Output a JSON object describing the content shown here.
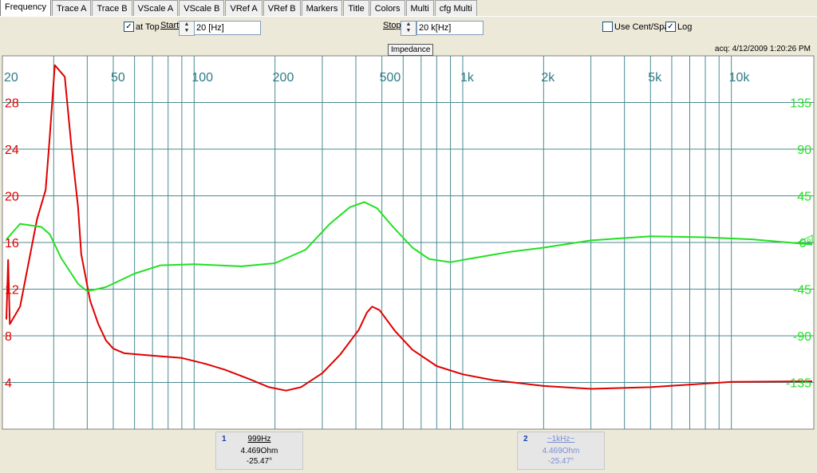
{
  "tabs": [
    "Frequency",
    "Trace A",
    "Trace B",
    "VScale A",
    "VScale B",
    "VRef A",
    "VRef B",
    "Markers",
    "Title",
    "Colors",
    "Multi",
    "cfg Multi"
  ],
  "active_tab": 0,
  "toolbar": {
    "at_top_label": "at Top",
    "at_top_checked": "✓",
    "start_label": "Start",
    "start_value": "20 [Hz]",
    "stop_label": "Stop",
    "stop_value": "20 k[Hz]",
    "use_cent_span_label": "Use Cent/Span",
    "use_cent_span_checked": "",
    "log_label": "Log",
    "log_checked": "✓"
  },
  "plot_title": "Impedance",
  "acq_time": "acq: 4/12/2009 1:20:26 PM",
  "markers": [
    {
      "num": "1",
      "freq": "999Hz",
      "mag": "4.469Ohm",
      "phase": "-25.47°"
    },
    {
      "num": "2",
      "freq": "~1kHz~",
      "mag": "4.469Ohm",
      "phase": "-25.47°"
    }
  ],
  "chart_data": {
    "type": "line",
    "title": "Impedance",
    "x_scale": "log",
    "xlim": [
      20,
      20000
    ],
    "x_ticks": [
      {
        "v": 20,
        "label": "20"
      },
      {
        "v": 50,
        "label": "50"
      },
      {
        "v": 100,
        "label": "100"
      },
      {
        "v": 200,
        "label": "200"
      },
      {
        "v": 500,
        "label": "500"
      },
      {
        "v": 1000,
        "label": "1k"
      },
      {
        "v": 2000,
        "label": "2k"
      },
      {
        "v": 5000,
        "label": "5k"
      },
      {
        "v": 10000,
        "label": "10k"
      }
    ],
    "ylim_left": [
      0,
      32
    ],
    "y_ticks_left": [
      4,
      8,
      12,
      16,
      20,
      24,
      28
    ],
    "ylim_right": [
      -180,
      180
    ],
    "y_ticks_right": [
      {
        "v": 135,
        "label": "135"
      },
      {
        "v": 90,
        "label": "90"
      },
      {
        "v": 45,
        "label": "45"
      },
      {
        "v": 0,
        "label": "0°"
      },
      {
        "v": -45,
        "label": "-45"
      },
      {
        "v": -90,
        "label": "-90"
      },
      {
        "v": -135,
        "label": "-135"
      }
    ],
    "grid": true,
    "colors": {
      "background": "#ffffff",
      "grid": "#4a8a92",
      "axis_text": "#2e7c86",
      "magnitude": "#e00000",
      "phase": "#22e022"
    },
    "series": [
      {
        "axis": "left",
        "color": "#e00000",
        "points": [
          [
            20,
            9.4
          ],
          [
            20.3,
            14.5
          ],
          [
            20.6,
            9.0
          ],
          [
            22.5,
            10.5
          ],
          [
            26,
            18
          ],
          [
            28,
            20.5
          ],
          [
            29,
            25
          ],
          [
            30.3,
            31.2
          ],
          [
            33,
            30.2
          ],
          [
            35,
            24
          ],
          [
            37,
            19
          ],
          [
            38,
            15
          ],
          [
            41,
            11
          ],
          [
            44,
            9
          ],
          [
            47,
            7.6
          ],
          [
            50,
            6.9
          ],
          [
            55,
            6.5
          ],
          [
            70,
            6.3
          ],
          [
            90,
            6.1
          ],
          [
            110,
            5.6
          ],
          [
            130,
            5.1
          ],
          [
            160,
            4.3
          ],
          [
            190,
            3.6
          ],
          [
            220,
            3.3
          ],
          [
            250,
            3.6
          ],
          [
            300,
            4.8
          ],
          [
            350,
            6.4
          ],
          [
            410,
            8.5
          ],
          [
            440,
            10.0
          ],
          [
            460,
            10.5
          ],
          [
            490,
            10.2
          ],
          [
            560,
            8.4
          ],
          [
            650,
            6.8
          ],
          [
            800,
            5.4
          ],
          [
            1000,
            4.7
          ],
          [
            1300,
            4.2
          ],
          [
            2000,
            3.7
          ],
          [
            3000,
            3.45
          ],
          [
            5000,
            3.6
          ],
          [
            10000,
            4.05
          ],
          [
            20000,
            4.1
          ]
        ]
      },
      {
        "axis": "right",
        "color": "#22e022",
        "points": [
          [
            20,
            3
          ],
          [
            22.5,
            18
          ],
          [
            27,
            15
          ],
          [
            29,
            8
          ],
          [
            32,
            -15
          ],
          [
            37,
            -40
          ],
          [
            40,
            -47
          ],
          [
            47,
            -43
          ],
          [
            60,
            -30
          ],
          [
            75,
            -22
          ],
          [
            100,
            -21
          ],
          [
            150,
            -23
          ],
          [
            200,
            -20
          ],
          [
            260,
            -7
          ],
          [
            320,
            18
          ],
          [
            380,
            34
          ],
          [
            430,
            39
          ],
          [
            480,
            33
          ],
          [
            550,
            15
          ],
          [
            650,
            -5
          ],
          [
            750,
            -16
          ],
          [
            900,
            -19
          ],
          [
            1100,
            -15
          ],
          [
            1500,
            -9
          ],
          [
            2000,
            -5
          ],
          [
            3000,
            2
          ],
          [
            5000,
            6
          ],
          [
            8000,
            5
          ],
          [
            12000,
            3
          ],
          [
            20000,
            -2
          ]
        ]
      }
    ]
  }
}
